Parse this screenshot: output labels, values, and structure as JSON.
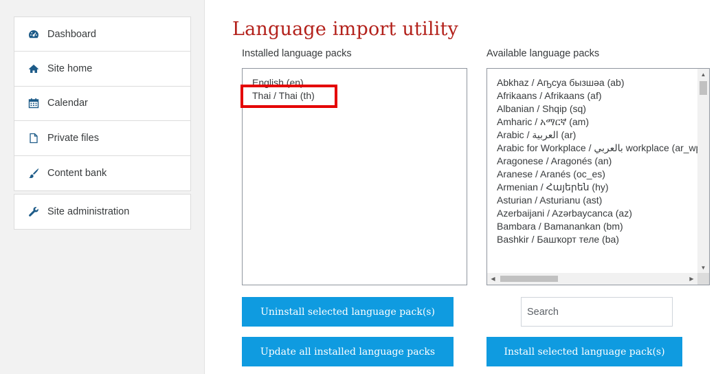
{
  "sidebar": {
    "group1": [
      {
        "label": "Dashboard",
        "icon": "dashboard-icon"
      },
      {
        "label": "Site home",
        "icon": "home-icon"
      },
      {
        "label": "Calendar",
        "icon": "calendar-icon"
      },
      {
        "label": "Private files",
        "icon": "file-icon"
      },
      {
        "label": "Content bank",
        "icon": "paint-brush-icon"
      }
    ],
    "group2": [
      {
        "label": "Site administration",
        "icon": "wrench-icon"
      }
    ]
  },
  "main": {
    "title": "Language import utility",
    "installed_label": "Installed language packs",
    "available_label": "Available language packs",
    "installed_packs": [
      "English (en)",
      "Thai / Thai (th)"
    ],
    "available_packs": [
      "Abkhaz / Аҧсуа бызшәа (ab)",
      "Afrikaans / Afrikaans (af)",
      "Albanian / Shqip (sq)",
      "Amharic / አማርኛ (am)",
      "Arabic / العربية (ar)",
      "Arabic for Workplace / بالعربي workplace (ar_wp)",
      "Aragonese / Aragonés (an)",
      "Aranese / Aranés (oc_es)",
      "Armenian / Հայերեն (hy)",
      "Asturian / Asturianu (ast)",
      "Azerbaijani / Azərbaycanca (az)",
      "Bambara / Bamanankan (bm)",
      "Bashkir / Башҡорт теле (ba)"
    ],
    "uninstall_button": "Uninstall selected language pack(s)",
    "update_button": "Update all installed language packs",
    "install_button": "Install selected language pack(s)",
    "search_placeholder": "Search"
  },
  "colors": {
    "title": "#b3211b",
    "button": "#0f9be0",
    "highlight": "#e40000",
    "sidebar_bg": "#f2f2f2"
  }
}
